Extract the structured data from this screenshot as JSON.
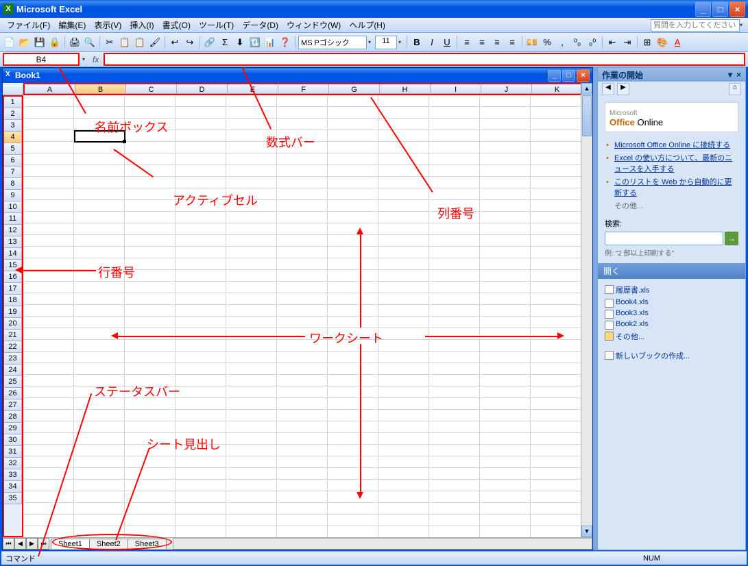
{
  "app": {
    "title": "Microsoft Excel"
  },
  "menu": [
    "ファイル(F)",
    "編集(E)",
    "表示(V)",
    "挿入(I)",
    "書式(O)",
    "ツール(T)",
    "データ(D)",
    "ウィンドウ(W)",
    "ヘルプ(H)"
  ],
  "help_placeholder": "質問を入力してください",
  "toolbar_icons": [
    "📄",
    "📂",
    "💾",
    "🔒",
    "🖨",
    "🔍",
    "✂",
    "📋",
    "📋",
    "🖌",
    "↩",
    "↪",
    "🔗",
    "Σ",
    "⬇",
    "🔃",
    "📊",
    "❓"
  ],
  "font": {
    "name": "MS Pゴシック",
    "size": "11"
  },
  "format_icons": [
    "B",
    "I",
    "U",
    "≡",
    "≡",
    "≡",
    "≡",
    "💴",
    "%",
    ",",
    "⁰₀",
    "₀⁰",
    "⇤",
    "⇥",
    "⊞",
    "🎨",
    "A"
  ],
  "name_box": "B4",
  "formula_bar": "",
  "workbook": {
    "title": "Book1"
  },
  "columns": [
    "A",
    "B",
    "C",
    "D",
    "E",
    "F",
    "G",
    "H",
    "I",
    "J",
    "K"
  ],
  "rows": [
    1,
    2,
    3,
    4,
    5,
    6,
    7,
    8,
    9,
    10,
    11,
    12,
    13,
    14,
    15,
    16,
    17,
    18,
    19,
    20,
    21,
    22,
    23,
    24,
    25,
    26,
    27,
    28,
    29,
    30,
    31,
    32,
    33,
    34,
    35
  ],
  "active_cell": "B4",
  "sheets": [
    "Sheet1",
    "Sheet2",
    "Sheet3"
  ],
  "active_sheet": 0,
  "taskpane": {
    "title": "作業の開始",
    "office_brand_pre": "Microsoft",
    "office_brand": "Office",
    "office_brand_post": "Online",
    "links": [
      "Microsoft Office Online に接続する",
      "Excel の使い方について、最新のニュースを入手する",
      "このリストを Web から自動的に更新する"
    ],
    "other": "その他...",
    "search_label": "検索:",
    "search_hint": "例: \"2 部以上印刷する\"",
    "open_label": "開く",
    "recent": [
      "履歴書.xls",
      "Book4.xls",
      "Book3.xls",
      "Book2.xls"
    ],
    "more": "その他...",
    "new_wb": "新しいブックの作成..."
  },
  "status": {
    "left": "コマンド",
    "num": "NUM"
  },
  "annotations": {
    "name_box": "名前ボックス",
    "formula_bar": "数式バー",
    "active_cell": "アクティブセル",
    "col_header": "列番号",
    "row_header": "行番号",
    "worksheet": "ワークシート",
    "status_bar": "ステータスバー",
    "sheet_tabs": "シート見出し"
  }
}
